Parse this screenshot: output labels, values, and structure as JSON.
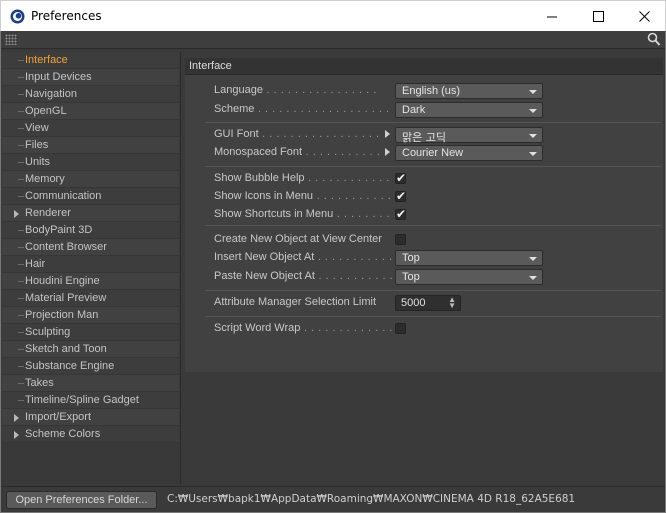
{
  "window": {
    "title": "Preferences",
    "controls": {
      "minimize": "—",
      "maximize": "☐",
      "close": "✕"
    }
  },
  "sidebar": {
    "items": [
      {
        "label": "Interface",
        "active": true,
        "expandable": false
      },
      {
        "label": "Input Devices",
        "expandable": false
      },
      {
        "label": "Navigation",
        "expandable": false
      },
      {
        "label": "OpenGL",
        "expandable": false
      },
      {
        "label": "View",
        "expandable": false
      },
      {
        "label": "Files",
        "expandable": false
      },
      {
        "label": "Units",
        "expandable": false
      },
      {
        "label": "Memory",
        "expandable": false
      },
      {
        "label": "Communication",
        "expandable": false
      },
      {
        "label": "Renderer",
        "expandable": true
      },
      {
        "label": "BodyPaint 3D",
        "expandable": false
      },
      {
        "label": "Content Browser",
        "expandable": false
      },
      {
        "label": "Hair",
        "expandable": false
      },
      {
        "label": "Houdini Engine",
        "expandable": false
      },
      {
        "label": "Material Preview",
        "expandable": false
      },
      {
        "label": "Projection Man",
        "expandable": false
      },
      {
        "label": "Sculpting",
        "expandable": false
      },
      {
        "label": "Sketch and Toon",
        "expandable": false
      },
      {
        "label": "Substance Engine",
        "expandable": false
      },
      {
        "label": "Takes",
        "expandable": false
      },
      {
        "label": "Timeline/Spline Gadget",
        "expandable": false
      },
      {
        "label": "Import/Export",
        "expandable": true
      },
      {
        "label": "Scheme Colors",
        "expandable": true
      }
    ]
  },
  "panel": {
    "title": "Interface",
    "language": {
      "label": "Language",
      "dots": " . . . . . . . . . . . . . . . .",
      "value": "English (us)"
    },
    "scheme": {
      "label": "Scheme",
      "dots": " . . . . . . . . . . . . . . . . . . .",
      "value": "Dark"
    },
    "gui_font": {
      "label": "GUI Font",
      "dots": " . . . . . . . . . . . . . . . . .",
      "value": "맑은 고딕"
    },
    "mono_font": {
      "label": "Monospaced Font",
      "dots": " . . . . . . . . . . . .",
      "value": "Courier New"
    },
    "bubble_help": {
      "label": "Show Bubble Help",
      "dots": " . . . . . . . . . . . .",
      "checked": true
    },
    "icons_menu": {
      "label": "Show Icons in Menu",
      "dots": " . . . . . . . . . . . .",
      "checked": true
    },
    "shortcuts_menu": {
      "label": "Show Shortcuts in Menu",
      "dots": " . . . . . . . . .",
      "checked": true
    },
    "create_new_object": {
      "label": "Create New Object at View Center",
      "checked": false
    },
    "insert_new_object": {
      "label": "Insert New Object At",
      "dots": " . . . . . . . . . . .",
      "value": "Top"
    },
    "paste_new_object": {
      "label": "Paste New Object At",
      "dots": " . . . . . . . . . . . .",
      "value": "Top"
    },
    "attr_limit": {
      "label": "Attribute Manager Selection Limit",
      "value": "5000"
    },
    "script_wrap": {
      "label": "Script Word Wrap",
      "dots": " . . . . . . . . . . . . . . .",
      "checked": false
    }
  },
  "footer": {
    "button_label": "Open Preferences Folder...",
    "path": "C:₩Users₩bapk1₩AppData₩Roaming₩MAXON₩CINEMA 4D R18_62A5E681"
  },
  "icons": {
    "app": "cinema4d-logo-icon",
    "toolbar_grip": "grip-dots-icon",
    "search": "search-icon",
    "check": "✔"
  }
}
